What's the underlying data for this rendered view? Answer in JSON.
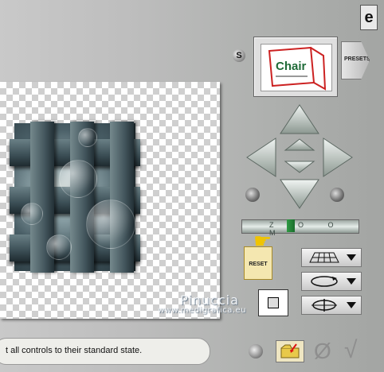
{
  "logo": {
    "glyph": "e"
  },
  "preset": {
    "s_label": "S",
    "presets_label": "PRESETS",
    "preview_text": "Chair"
  },
  "zoom": {
    "label": "Z O O M"
  },
  "reset": {
    "label": "RESET"
  },
  "status": {
    "text": "t all controls to their standard state."
  },
  "watermark": {
    "line1": "Pinuccia",
    "line2": "www.medigrafica.eu"
  },
  "icons": [
    "logo-icon",
    "s-button-icon",
    "arrow-up-icon",
    "arrow-down-icon",
    "arrow-left-icon",
    "arrow-right-icon",
    "nudge-up-icon",
    "nudge-down-icon",
    "rotate-left-icon",
    "rotate-right-icon",
    "hand-pointer-icon",
    "grid-plane-icon",
    "rotate-flat-icon",
    "rotate-vertical-icon",
    "grid-icon",
    "folder-icon",
    "cancel-icon",
    "ok-check-icon"
  ],
  "colors": {
    "accent_green": "#2f9a44",
    "reset_bg": "#f4e7b0"
  }
}
